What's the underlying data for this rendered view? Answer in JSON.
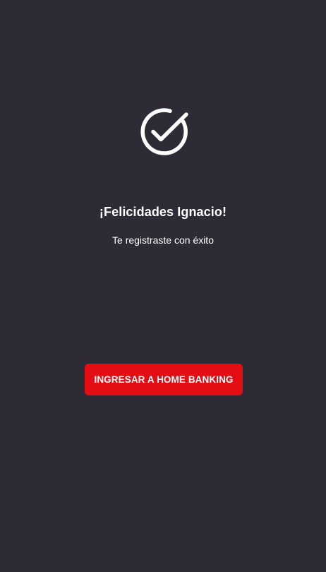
{
  "success": {
    "icon": "check-circle-icon",
    "title": "¡Felicidades Ignacio!",
    "subtitle": "Te registraste con éxito"
  },
  "actions": {
    "primary_label": "INGRESAR A HOME BANKING"
  },
  "colors": {
    "background": "#2e2b37",
    "accent": "#e30d13",
    "text": "#ffffff"
  }
}
